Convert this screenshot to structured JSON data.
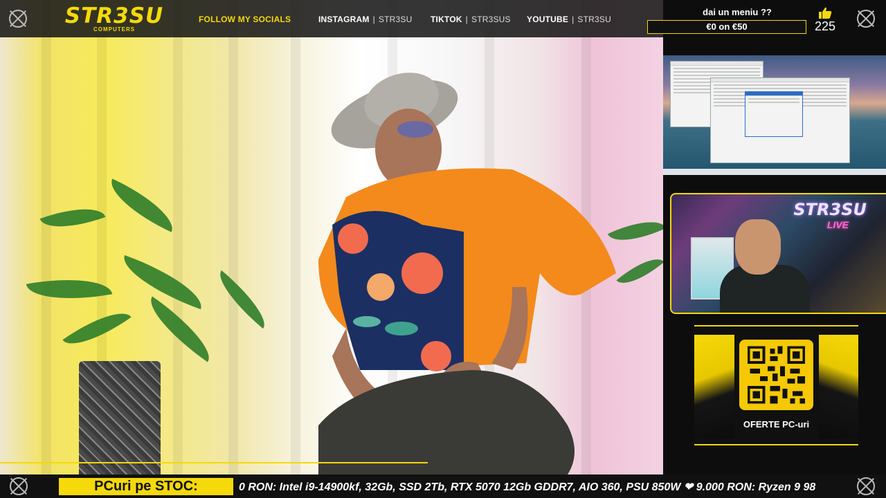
{
  "header": {
    "logo_text": "STR3SU",
    "logo_subtext": "COMPUTERS",
    "follow_label": "FOLLOW MY SOCIALS",
    "socials": [
      {
        "platform": "INSTAGRAM",
        "handle": "STR3SU"
      },
      {
        "platform": "TIKTOK",
        "handle": "STR3SUS"
      },
      {
        "platform": "YOUTUBE",
        "handle": "STR3SU"
      }
    ]
  },
  "goal": {
    "label": "dai un meniu ??",
    "progress_text": "€0 on €50",
    "progress_fraction": 0
  },
  "likes": {
    "icon": "thumbs-up-icon",
    "count": "225"
  },
  "webcam": {
    "brand": "STR3SU",
    "live": "LIVE"
  },
  "promo": {
    "caption": "OFERTE PC-uri",
    "icon": "qr-code"
  },
  "ticker": {
    "label": "PCuri pe STOC:",
    "text": "0 RON: Intel i9-14900kf, 32Gb, SSD 2Tb, RTX 5070 12Gb GDDR7, AIO 360, PSU 850W  ❤ 9.000 RON: Ryzen 9 98"
  },
  "colors": {
    "accent": "#f5d90a",
    "background": "#0d0d0d",
    "topbar": "#191919"
  }
}
